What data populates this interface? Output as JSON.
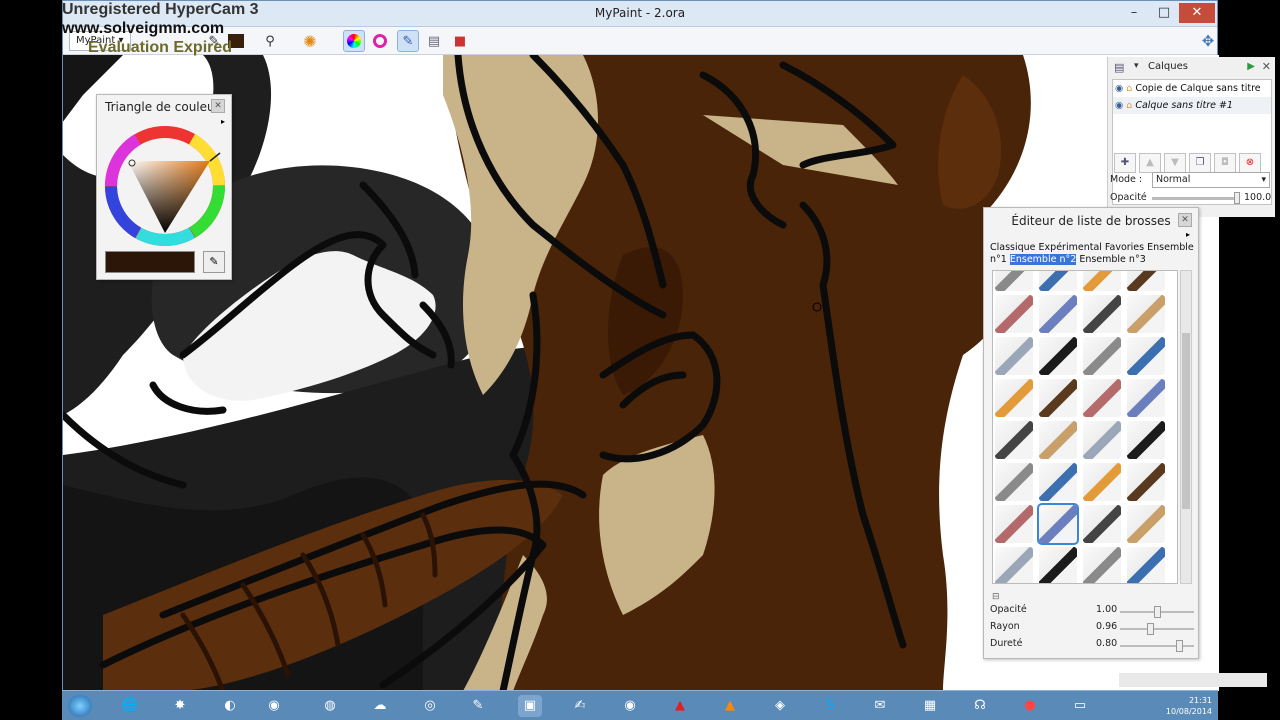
{
  "watermark": {
    "line1": "Unregistered HyperCam 3",
    "line2": "www.solveigmm.com",
    "line3": "Evaluation Expired"
  },
  "window": {
    "title": "MyPaint - 2.ora",
    "min": "–",
    "max": "□",
    "close": "✕"
  },
  "toolbar": {
    "menu_label": "MyPaint ▾"
  },
  "color_panel": {
    "title": "Triangle de couleur",
    "current_color": "#2b1608"
  },
  "layers_panel": {
    "title": "Calques",
    "layers": [
      {
        "name": "Copie de Calque sans titre"
      },
      {
        "name": "Calque sans titre #1"
      }
    ],
    "mode_label": "Mode :",
    "mode_value": "Normal",
    "opacity_label": "Opacité",
    "opacity_value": "100.0"
  },
  "brush_panel": {
    "title": "Éditeur de liste de brosses",
    "tabs_before": "Classique Expérimental Favories Ensemble n°1",
    "tab_selected": "Ensemble n°2",
    "tabs_after": "Ensemble n°3",
    "params": [
      {
        "label": "Opacité",
        "value": "1.00",
        "fraction": 0.48
      },
      {
        "label": "Rayon",
        "value": "0.96",
        "fraction": 0.38
      },
      {
        "label": "Dureté",
        "value": "0.80",
        "fraction": 0.8
      }
    ]
  },
  "clock": {
    "time": "21:31",
    "date": "10/08/2014"
  },
  "colors": {
    "brown": "#4a2408",
    "tan": "#c9b48a",
    "black": "#0b0b0b",
    "dark_gray": "#222222",
    "selection_blue": "#3875d7"
  }
}
